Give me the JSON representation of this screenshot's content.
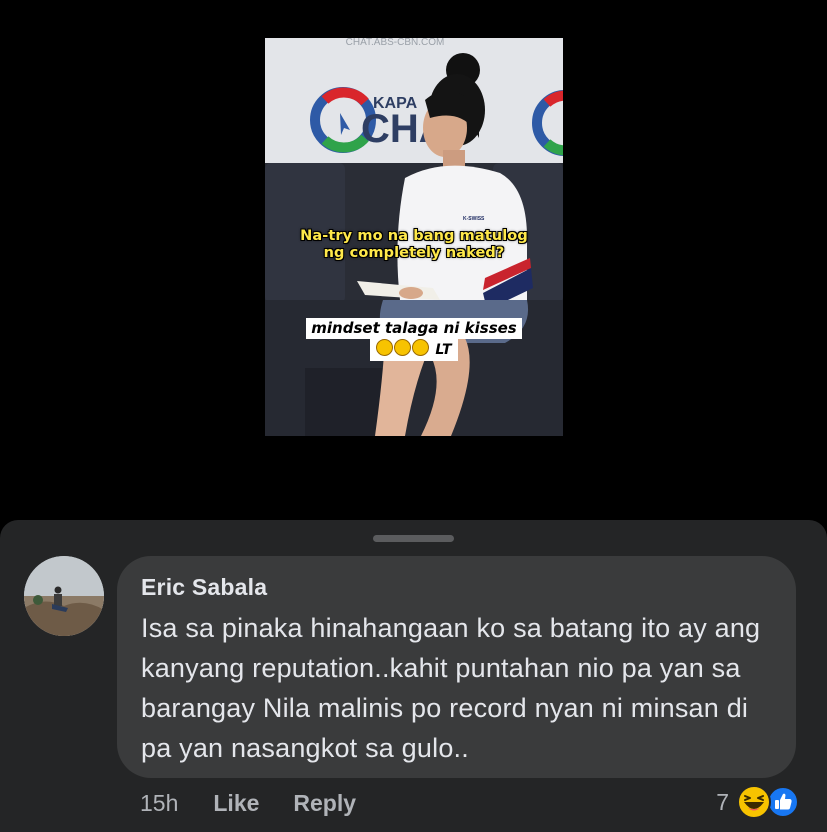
{
  "video": {
    "watermark": "CHAT.ABS-CBN.COM",
    "logo_text": "KAPA",
    "logo_big": "CHA",
    "caption_line1": "Na-try mo na bang matulog",
    "caption_line2": "ng completely naked?",
    "overlay_line1": "mindset talaga ni kisses",
    "overlay_line2": "LT",
    "shirt_brand": "K-SWISS"
  },
  "comment": {
    "author": "Eric Sabala",
    "text": "Isa sa pinaka hinahangaan ko sa batang ito ay ang kanyang reputation..kahit puntahan nio pa yan sa barangay Nila malinis po record nyan ni minsan di pa yan nasangkot sa gulo..",
    "time": "15h",
    "like_label": "Like",
    "reply_label": "Reply",
    "reaction_count": "7",
    "reaction_icons": [
      "haha-icon",
      "like-icon"
    ]
  },
  "colors": {
    "sheet_bg": "#242526",
    "bubble_bg": "#3a3b3c",
    "text_primary": "#e4e6eb",
    "text_secondary": "#b0b3b8",
    "like_blue": "#1877f2",
    "haha_yellow": "#f7c300"
  }
}
